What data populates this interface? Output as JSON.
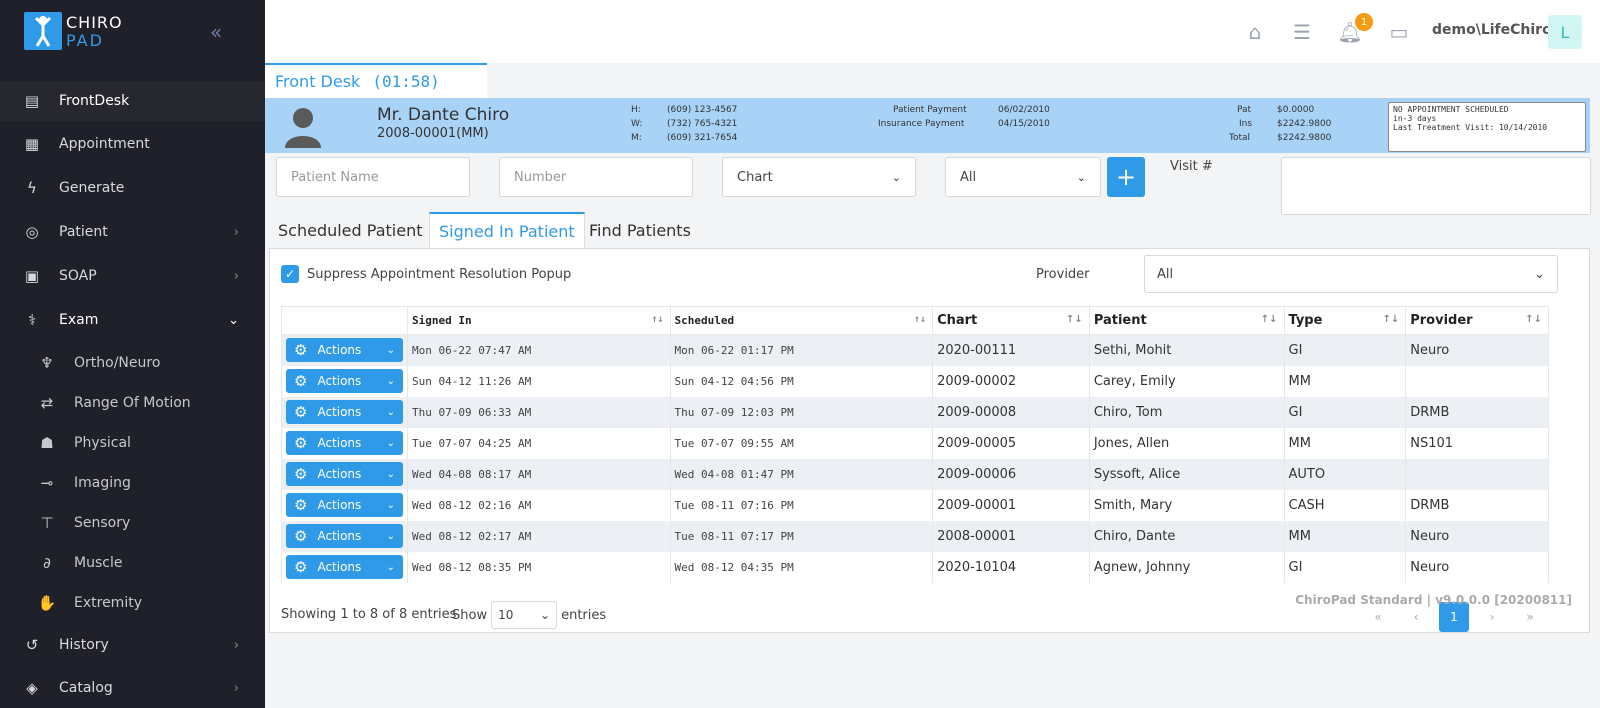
{
  "brand": {
    "line1": "CHIRO",
    "line2": "PAD"
  },
  "sidebar": {
    "items": [
      {
        "label": "FrontDesk",
        "icon": "frontdesk-icon"
      },
      {
        "label": "Appointment",
        "icon": "calendar-icon"
      },
      {
        "label": "Generate",
        "icon": "bolt-icon"
      },
      {
        "label": "Patient",
        "icon": "patient-icon"
      },
      {
        "label": "SOAP",
        "icon": "file-plus-icon"
      },
      {
        "label": "Exam",
        "icon": "stethoscope-icon"
      },
      {
        "label": "History",
        "icon": "history-icon"
      },
      {
        "label": "Catalog",
        "icon": "layers-icon"
      }
    ],
    "exam_sub": [
      {
        "label": "Ortho/Neuro",
        "icon": "ortho-icon"
      },
      {
        "label": "Range Of Motion",
        "icon": "arrows-icon"
      },
      {
        "label": "Physical",
        "icon": "physician-icon"
      },
      {
        "label": "Imaging",
        "icon": "imaging-icon"
      },
      {
        "label": "Sensory",
        "icon": "sensory-icon"
      },
      {
        "label": "Muscle",
        "icon": "muscle-icon"
      },
      {
        "label": "Extremity",
        "icon": "hand-icon"
      }
    ]
  },
  "topbar": {
    "notification_count": "1",
    "user": "demo\\LifeChiro",
    "avatar_letter": "L"
  },
  "frontdesk_tab": {
    "label": "Front Desk",
    "timer": "(01:58)"
  },
  "patient": {
    "name": "Mr. Dante Chiro",
    "id": "2008-00001(MM)",
    "phones": [
      {
        "label": "H:",
        "value": "(609) 123-4567"
      },
      {
        "label": "W:",
        "value": "(732) 765-4321"
      },
      {
        "label": "M:",
        "value": "(609) 321-7654"
      }
    ],
    "payments": [
      {
        "label": "Patient Payment",
        "value": "06/02/2010"
      },
      {
        "label": "Insurance Payment",
        "value": "04/15/2010"
      }
    ],
    "balances": [
      {
        "label": "Pat",
        "value": "$0.0000"
      },
      {
        "label": "Ins",
        "value": "$2242.9800"
      },
      {
        "label": "Total",
        "value": "$2242.9800"
      }
    ],
    "note": "NO APPOINTMENT SCHEDULED\nin-3 days\nLast Treatment Visit: 10/14/2010"
  },
  "search": {
    "patient_name_placeholder": "Patient Name",
    "number_placeholder": "Number",
    "type_value": "Chart",
    "filter_value": "All",
    "visit_label": "Visit #"
  },
  "tabs": [
    "Scheduled Patient",
    "Signed In Patient",
    "Find Patients"
  ],
  "panel": {
    "suppress_label": "Suppress Appointment Resolution Popup",
    "provider_label": "Provider",
    "provider_value": "All"
  },
  "table": {
    "columns": [
      "",
      "Signed In",
      "Scheduled",
      "Chart",
      "Patient",
      "Type",
      "Provider"
    ],
    "action_label": "Actions",
    "rows": [
      {
        "signed_in": "Mon 06-22 07:47 AM",
        "scheduled": "Mon 06-22 01:17 PM",
        "chart": "2020-00111",
        "patient": "Sethi, Mohit",
        "type": "GI",
        "provider": "Neuro"
      },
      {
        "signed_in": "Sun 04-12 11:26 AM",
        "scheduled": "Sun 04-12 04:56 PM",
        "chart": "2009-00002",
        "patient": "Carey, Emily",
        "type": "MM",
        "provider": ""
      },
      {
        "signed_in": "Thu 07-09 06:33 AM",
        "scheduled": "Thu 07-09 12:03 PM",
        "chart": "2009-00008",
        "patient": "Chiro, Tom",
        "type": "GI",
        "provider": "DRMB"
      },
      {
        "signed_in": "Tue 07-07 04:25 AM",
        "scheduled": "Tue 07-07 09:55 AM",
        "chart": "2009-00005",
        "patient": "Jones, Allen",
        "type": "MM",
        "provider": "NS101"
      },
      {
        "signed_in": "Wed 04-08 08:17 AM",
        "scheduled": "Wed 04-08 01:47 PM",
        "chart": "2009-00006",
        "patient": "Syssoft, Alice",
        "type": "AUTO",
        "provider": ""
      },
      {
        "signed_in": "Wed 08-12 02:16 AM",
        "scheduled": "Tue 08-11 07:16 PM",
        "chart": "2009-00001",
        "patient": "Smith, Mary",
        "type": "CASH",
        "provider": "DRMB"
      },
      {
        "signed_in": "Wed 08-12 02:17 AM",
        "scheduled": "Tue 08-11 07:17 PM",
        "chart": "2008-00001",
        "patient": "Chiro, Dante",
        "type": "MM",
        "provider": "Neuro"
      },
      {
        "signed_in": "Wed 08-12 08:35 PM",
        "scheduled": "Wed 08-12 04:35 PM",
        "chart": "2020-10104",
        "patient": "Agnew, Johnny",
        "type": "GI",
        "provider": "Neuro"
      }
    ]
  },
  "footer": {
    "showing": "Showing 1 to 8 of 8 entries",
    "show_label": "Show",
    "length_value": "10",
    "entries_label": "entries",
    "pages": [
      "«",
      "‹",
      "1",
      "›",
      "»"
    ],
    "version": "ChiroPad Standard | v9.0.0.0 [20200811]"
  },
  "colors": {
    "accent": "#2f9be8",
    "sidebar_bg": "#1f2029",
    "banner_bg": "#a9d2f7",
    "badge": "#f39c12"
  }
}
